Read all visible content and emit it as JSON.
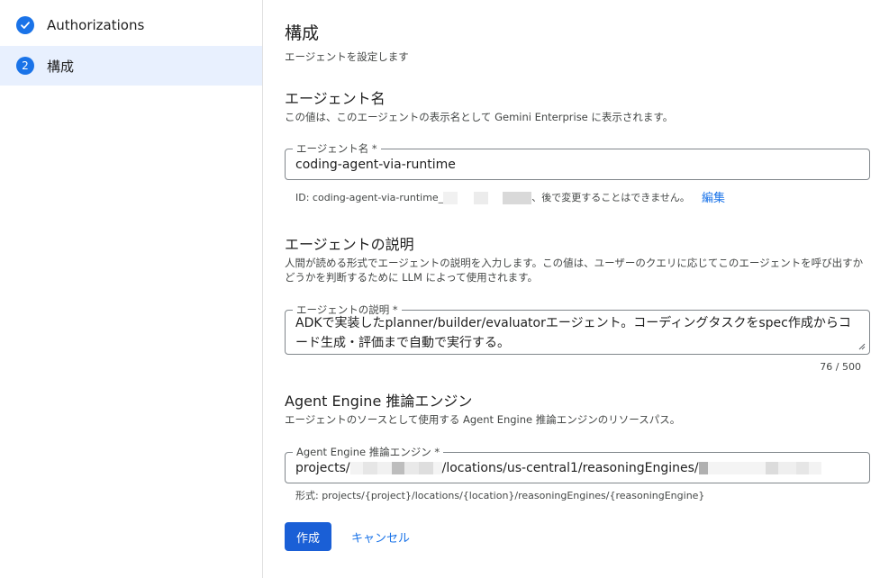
{
  "sidebar": {
    "steps": [
      {
        "label": "Authorizations",
        "state": "completed",
        "icon": "check-icon"
      },
      {
        "number": "2",
        "label": "構成",
        "state": "active"
      }
    ]
  },
  "main": {
    "title": "構成",
    "subtitle": "エージェントを設定します",
    "agent_name": {
      "section_title": "エージェント名",
      "description": "この値は、このエージェントの表示名として Gemini Enterprise に表示されます。",
      "field_label": "エージェント名 *",
      "value": "coding-agent-via-runtime",
      "id_prefix": "ID: coding-agent-via-runtime_",
      "id_suffix": "、後で変更することはできません。",
      "edit_label": "編集"
    },
    "agent_description": {
      "section_title": "エージェントの説明",
      "description": "人間が読める形式でエージェントの説明を入力します。この値は、ユーザーのクエリに応じてこのエージェントを呼び出すかどうかを判断するために LLM によって使用されます。",
      "field_label": "エージェントの説明 *",
      "value": "ADKで実装したplanner/builder/evaluatorエージェント。コーディングタスクをspec作成からコード生成・評価まで自動で実行する。",
      "counter": "76 / 500"
    },
    "agent_engine": {
      "section_title": "Agent Engine 推論エンジン",
      "description": "エージェントのソースとして使用する Agent Engine 推論エンジンのリソースパス。",
      "field_label": "Agent Engine 推論エンジン *",
      "value_prefix": "projects/",
      "value_middle": "/locations/us-central1/reasoningEngines/",
      "format_hint": "形式: projects/{project}/locations/{location}/reasoningEngines/{reasoningEngine}"
    },
    "actions": {
      "create_label": "作成",
      "cancel_label": "キャンセル"
    }
  },
  "colors": {
    "accent": "#1a73e8",
    "active_step_bg": "#e8f0fe",
    "primary_button": "#1a5fd6"
  }
}
